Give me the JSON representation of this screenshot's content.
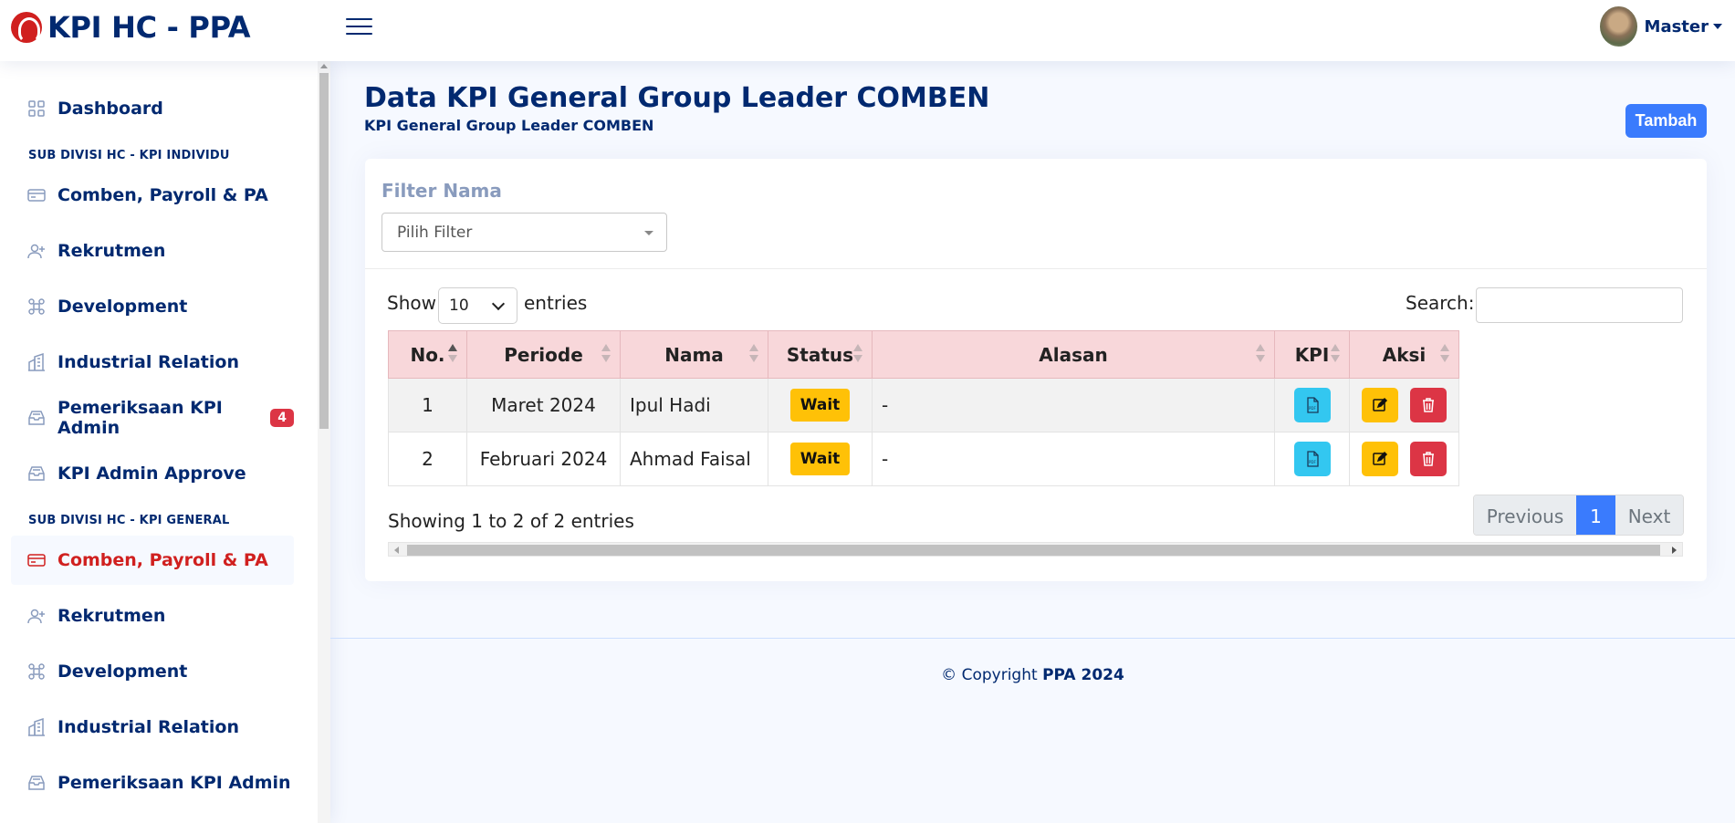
{
  "header": {
    "app_title": "KPI HC - PPA",
    "user_name": "Master"
  },
  "sidebar": {
    "dashboard": "Dashboard",
    "heading_individu": "SUB DIVISI HC - KPI INDIVIDU",
    "individu_items": [
      {
        "label": "Comben, Payroll & PA",
        "icon": "card-icon"
      },
      {
        "label": "Rekrutmen",
        "icon": "person-add-icon"
      },
      {
        "label": "Development",
        "icon": "command-icon"
      },
      {
        "label": "Industrial Relation",
        "icon": "building-icon"
      },
      {
        "label": "Pemeriksaan KPI Admin",
        "icon": "inbox-icon",
        "badge": "4"
      },
      {
        "label": "KPI Admin Approve",
        "icon": "inbox-icon"
      }
    ],
    "heading_general": "SUB DIVISI HC - KPI GENERAL",
    "general_items": [
      {
        "label": "Comben, Payroll & PA",
        "icon": "card-icon",
        "active": true
      },
      {
        "label": "Rekrutmen",
        "icon": "person-add-icon"
      },
      {
        "label": "Development",
        "icon": "command-icon"
      },
      {
        "label": "Industrial Relation",
        "icon": "building-icon"
      },
      {
        "label": "Pemeriksaan KPI Admin",
        "icon": "inbox-icon"
      }
    ]
  },
  "page": {
    "title": "Data KPI General Group Leader COMBEN",
    "subtitle": "KPI General Group Leader COMBEN",
    "add_button": "Tambah"
  },
  "filter": {
    "label": "Filter Nama",
    "placeholder": "Pilih Filter"
  },
  "table_controls": {
    "show": "Show",
    "length": "10",
    "entries": "entries",
    "search_label": "Search:"
  },
  "table": {
    "columns": [
      "No.",
      "Periode",
      "Nama",
      "Status",
      "Alasan",
      "KPI",
      "Aksi"
    ],
    "rows": [
      {
        "no": "1",
        "periode": "Maret 2024",
        "nama": "Ipul Hadi",
        "status": "Wait",
        "alasan": "-"
      },
      {
        "no": "2",
        "periode": "Februari 2024",
        "nama": "Ahmad Faisal",
        "status": "Wait",
        "alasan": "-"
      }
    ]
  },
  "pagination": {
    "info": "Showing 1 to 2 of 2 entries",
    "previous": "Previous",
    "current": "1",
    "next": "Next"
  },
  "footer": {
    "prefix": "© Copyright",
    "brand": "PPA 2024"
  },
  "colors": {
    "navy": "#012970",
    "primary": "#3a7bfd",
    "warning": "#ffc107",
    "danger": "#dc3545",
    "info": "#33c7f0",
    "table_header": "#f8d7da"
  }
}
